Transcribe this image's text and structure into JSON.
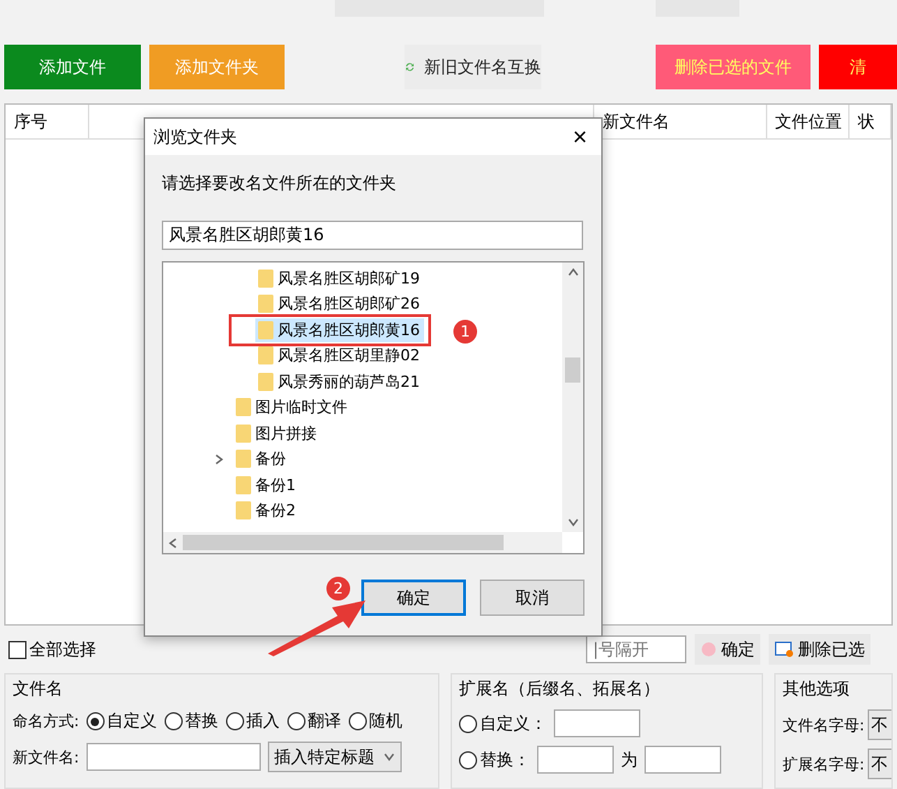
{
  "top_buttons": [
    {
      "label": "添加文件",
      "color": "#0b8a1e"
    },
    {
      "label": "添加文件夹",
      "color": "#f09c23"
    },
    {
      "label": "新旧文件名互换",
      "color": "#ececec"
    },
    {
      "label": "删除已选的文件",
      "color": "#ff5a78"
    },
    {
      "label": "清",
      "color": "#ff0000"
    }
  ],
  "table": {
    "columns": [
      "序号",
      "新文件名",
      "文件位置",
      "状"
    ]
  },
  "dialog": {
    "title": "浏览文件夹",
    "close": "×",
    "instruction": "请选择要改名文件所在的文件夹",
    "path": "风景名胜区胡郎黄16",
    "tree": [
      {
        "children": [
          {
            "label": "风景名胜区胡郎矿19",
            "selected": false,
            "expandable": false
          },
          {
            "label": "风景名胜区胡郎矿26",
            "selected": false,
            "expandable": false
          },
          {
            "label": "风景名胜区胡郎黄16",
            "selected": true,
            "expandable": false
          },
          {
            "label": "风景名胜区胡里静02",
            "selected": false,
            "expandable": false
          },
          {
            "label": "风景秀丽的葫芦岛21",
            "selected": false,
            "expandable": false
          }
        ]
      },
      {
        "label": "图片临时文件",
        "selected": false,
        "expandable": false
      },
      {
        "label": "图片拼接",
        "selected": false,
        "expandable": false
      },
      {
        "label": "备份",
        "selected": false,
        "expandable": true
      },
      {
        "label": "备份1",
        "selected": false,
        "expandable": false
      },
      {
        "label": "备份2",
        "selected": false,
        "expandable": false
      }
    ],
    "buttons": [
      {
        "label": "确定",
        "selected": true
      },
      {
        "label": "取消",
        "selected": false
      }
    ],
    "badges": [
      "1",
      "2"
    ]
  },
  "toolbar": {
    "select_all": {
      "label": "全部选择",
      "checked": false
    },
    "filter_placeholder": "|号隔开",
    "confirm": "确定",
    "delete": "删除已选"
  },
  "filename_panel": {
    "title": "文件名",
    "mode_label": "命名方式:",
    "modes": [
      {
        "label": "自定义",
        "selected": true
      },
      {
        "label": "替换",
        "selected": false
      },
      {
        "label": "插入",
        "selected": false
      },
      {
        "label": "翻译",
        "selected": false
      },
      {
        "label": "随机",
        "selected": false
      }
    ],
    "new_name_label": "新文件名:",
    "insert_select": "插入特定标题"
  },
  "extension_panel": {
    "title": "扩展名（后缀名、拓展名）",
    "custom": {
      "label": "自定义：",
      "selected": false
    },
    "replace": {
      "label": "替换：",
      "selected": false
    },
    "to": "为"
  },
  "other_panel": {
    "title": "其他选项",
    "rows": [
      {
        "label": "文件名字母:",
        "value": "不"
      },
      {
        "label": "扩展名字母:",
        "value": "不"
      }
    ]
  }
}
